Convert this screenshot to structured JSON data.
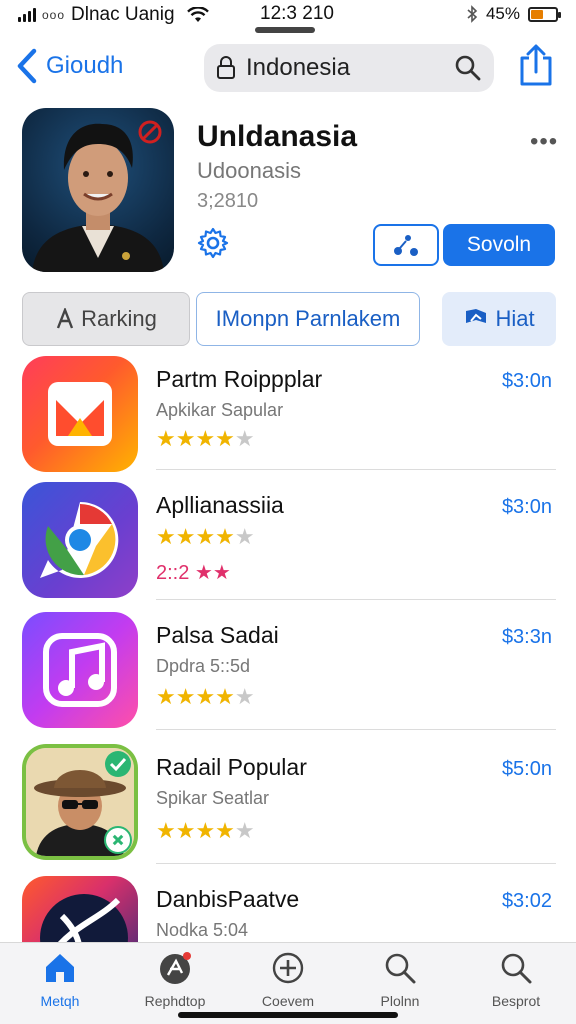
{
  "status_bar": {
    "dots": "ooo",
    "carrier": "Dlnac Uanig",
    "time": "12:3 210",
    "battery": "45%",
    "battery_level": 0.45
  },
  "nav": {
    "back_label": "Gioudh",
    "search_text": "Indonesia"
  },
  "hero": {
    "title": "Unldanasia",
    "subtitle": "Udoonasis",
    "meta": "3;2810",
    "more": "•••",
    "primary_label": "Sovoln"
  },
  "segments": [
    {
      "label": "Rarking"
    },
    {
      "label": "IMonpn Parnlakem"
    },
    {
      "label": "Hiat"
    }
  ],
  "apps": [
    {
      "name": "Partm Roippplar",
      "subtitle": "Apkikar Sapular",
      "price": "$3:0n",
      "rating": 4
    },
    {
      "name": "Apllianassiia",
      "subtitle": "",
      "price": "$3:0n",
      "rating": 4,
      "extra": "2::2 ★★"
    },
    {
      "name": "Palsa Sadai",
      "subtitle": "Dpdra 5::5d",
      "price": "$3:3n",
      "rating": 4
    },
    {
      "name": "Radail Popular",
      "subtitle": "Spikar Seatlar",
      "price": "$5:0n",
      "rating": 4
    },
    {
      "name": "DanbisPaatve",
      "subtitle": "Nodka 5:04",
      "price": "$3:02"
    }
  ],
  "tabs": [
    {
      "label": "Metqh",
      "icon": "home-icon"
    },
    {
      "label": "Rephdtop",
      "icon": "apps-icon"
    },
    {
      "label": "Coevem",
      "icon": "plus-circle-icon"
    },
    {
      "label": "Plolnn",
      "icon": "search-icon"
    },
    {
      "label": "Besprot",
      "icon": "search-icon"
    }
  ],
  "colors": {
    "accent": "#1a73e8",
    "star": "#f0b400",
    "star_off": "#c8c8c8",
    "pink_star": "#e0306b"
  }
}
